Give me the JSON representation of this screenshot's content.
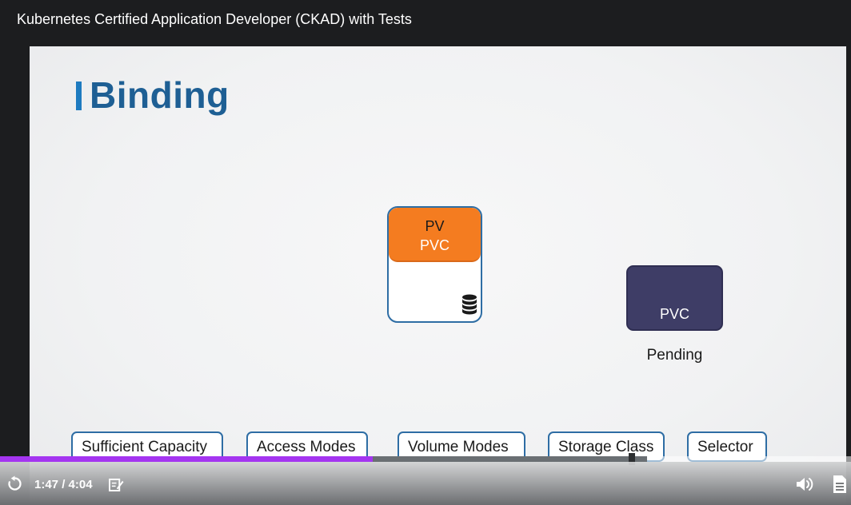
{
  "header": {
    "course_title": "Kubernetes Certified Application Developer (CKAD) with Tests"
  },
  "slide": {
    "heading": "Binding",
    "pv_card": {
      "top_label": "PV",
      "bottom_label": "PVC",
      "icon": "database-icon"
    },
    "pvc_box": {
      "label": "PVC"
    },
    "status": "Pending",
    "criteria": [
      "Sufficient Capacity",
      "Access Modes",
      "Volume Modes",
      "Storage Class",
      "Selector"
    ]
  },
  "player": {
    "time": "1:47 / 4:04",
    "progress_fraction": 0.438,
    "buffered_fraction": 0.76,
    "icons": [
      "rewind-icon",
      "notes-icon",
      "volume-icon",
      "transcript-icon"
    ]
  },
  "colors": {
    "accent_purple": "#a435f0",
    "heading_blue": "#1e5f94",
    "pv_orange": "#f47c20",
    "pvc_navy": "#3e3d66",
    "border_blue": "#2e6da4"
  }
}
